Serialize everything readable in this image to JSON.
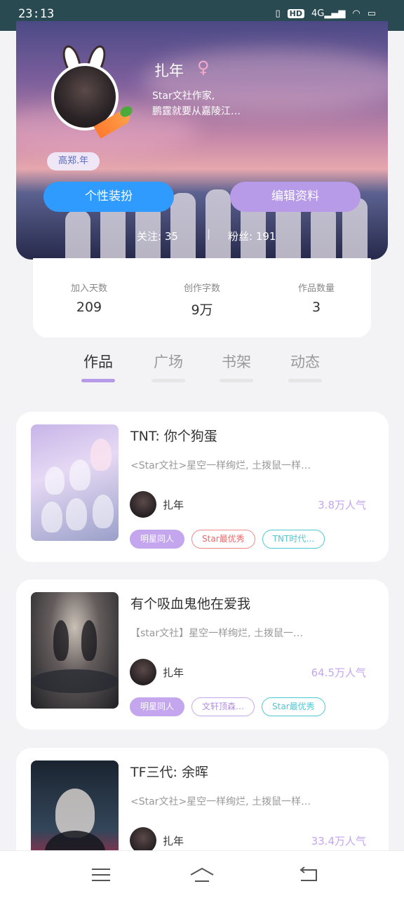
{
  "status": {
    "time": "23:13",
    "icons": [
      "vibrate-icon",
      "hd-icon",
      "signal-4g-icon",
      "wifi-icon",
      "battery-icon"
    ],
    "hd": "HD",
    "net": "4G"
  },
  "profile": {
    "name": "扎年",
    "gender_symbol": "♀",
    "bio_line1": "Star文社作家,",
    "bio_line2": "鹏霆就要从嘉陵江…",
    "nickname_tag": "高郑.年",
    "dress_button": "个性装扮",
    "edit_button": "编辑资料",
    "following": "关注: 35",
    "followers": "粉丝: 191",
    "separator": "|"
  },
  "stats": [
    {
      "label": "加入天数",
      "value": "209"
    },
    {
      "label": "创作字数",
      "value": "9万"
    },
    {
      "label": "作品数量",
      "value": "3"
    }
  ],
  "tabs": [
    {
      "label": "作品",
      "active": true
    },
    {
      "label": "广场",
      "active": false
    },
    {
      "label": "书架",
      "active": false
    },
    {
      "label": "动态",
      "active": false
    }
  ],
  "works": [
    {
      "title": "TNT: 你个狗蛋",
      "desc": "<Star文社>星空一样绚烂, 土拨鼠一样…",
      "author": "扎年",
      "popularity": "3.8万人气",
      "tags": [
        "明星同人",
        "Star最优秀",
        "TNT时代…"
      ]
    },
    {
      "title": "有个吸血鬼他在爱我",
      "desc": "【star文社】星空一样绚烂, 土拨鼠一…",
      "author": "扎年",
      "popularity": "64.5万人气",
      "tags": [
        "明星同人",
        "文轩顶森…",
        "Star最优秀"
      ]
    },
    {
      "title": "TF三代: 余晖",
      "desc": "<Star文社>星空一样绚烂, 土拨鼠一样…",
      "author": "扎年",
      "popularity": "33.4万人气",
      "tags": []
    }
  ],
  "colors": {
    "accent_purple": "#b79be9",
    "accent_blue": "#2f9bff",
    "status_bar": "#2a4a52"
  }
}
